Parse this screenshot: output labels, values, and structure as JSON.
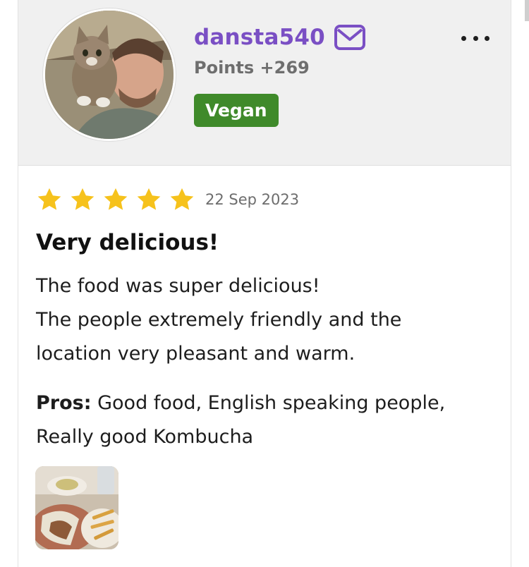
{
  "user": {
    "username": "dansta540",
    "points": "Points +269",
    "badge": "Vegan"
  },
  "review": {
    "rating": 5,
    "rating_max": 5,
    "date": "22 Sep 2023",
    "title": "Very delicious!",
    "body_lines": [
      "The food was super delicious!",
      "The people extremely friendly and the",
      "location very pleasant and warm."
    ],
    "pros_label": "Pros:",
    "pros_text": " Good food, English speaking people, Really good Kombucha"
  },
  "icons": {
    "mail": "mail-icon",
    "more": "more-options-icon",
    "star": "star-icon"
  },
  "colors": {
    "username": "#7a4fc4",
    "badge_bg": "#3f8a2a",
    "star": "#f6c21c",
    "header_bg": "#f0f0f0"
  }
}
